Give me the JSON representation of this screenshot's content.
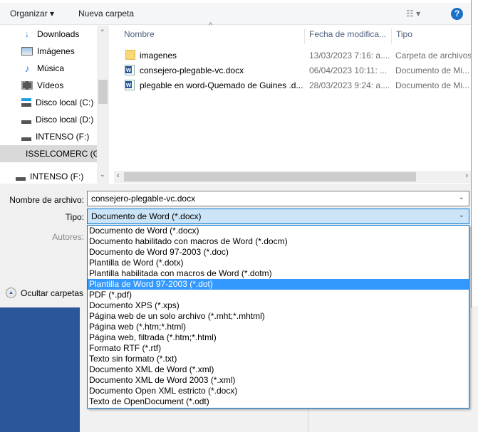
{
  "toolbar": {
    "organize": "Organizar ▾",
    "new_folder": "Nueva carpeta",
    "view_icon": "view-details-icon",
    "help": "?"
  },
  "nav": {
    "items": [
      {
        "label": "Downloads",
        "icon": "download-arrow-icon"
      },
      {
        "label": "Imágenes",
        "icon": "pictures-icon"
      },
      {
        "label": "Música",
        "icon": "music-note-icon"
      },
      {
        "label": "Vídeos",
        "icon": "video-icon"
      },
      {
        "label": "Disco local (C:)",
        "icon": "drive-windows-icon"
      },
      {
        "label": "Disco local (D:)",
        "icon": "drive-icon"
      },
      {
        "label": "INTENSO (F:)",
        "icon": "usb-drive-icon"
      },
      {
        "label": "ISSELCOMERC (G:)",
        "icon": "usb-drive-icon"
      },
      {
        "label": "INTENSO (F:)",
        "icon": "usb-drive-icon"
      }
    ]
  },
  "columns": {
    "name": "Nombre",
    "date": "Fecha de modifica...",
    "type": "Tipo"
  },
  "files": [
    {
      "name": "imagenes",
      "date": "13/03/2023 7:16: a....",
      "type": "Carpeta de archivos",
      "icon": "folder-icon"
    },
    {
      "name": "consejero-plegable-vc.docx",
      "date": "06/04/2023 10:11: ...",
      "type": "Documento de Mi...",
      "icon": "word-doc-icon"
    },
    {
      "name": "plegable en word-Quemado de Guines .d...",
      "date": "28/03/2023 9:24: a....",
      "type": "Documento de Mi...",
      "icon": "word-doc-icon"
    }
  ],
  "form": {
    "filename_label": "Nombre de archivo:",
    "filename_value": "consejero-plegable-vc.docx",
    "type_label": "Tipo:",
    "type_value": "Documento de Word (*.docx)",
    "authors_label": "Autores:",
    "hide_folders": "Ocultar carpetas"
  },
  "type_options": [
    "Documento de Word (*.docx)",
    "Documento habilitado con macros de Word (*.docm)",
    "Documento de Word 97-2003 (*.doc)",
    "Plantilla de Word (*.dotx)",
    "Plantilla habilitada con macros de Word (*.dotm)",
    "Plantilla de Word 97-2003 (*.dot)",
    "PDF (*.pdf)",
    "Documento XPS (*.xps)",
    "Página web de un solo archivo (*.mht;*.mhtml)",
    "Página web (*.htm;*.html)",
    "Página web, filtrada (*.htm;*.html)",
    "Formato RTF (*.rtf)",
    "Texto sin formato (*.txt)",
    "Documento XML de Word (*.xml)",
    "Documento XML de Word 2003 (*.xml)",
    "Documento Open XML estricto (*.docx)",
    "Texto de OpenDocument (*.odt)"
  ],
  "highlighted_option": "Plantilla de Word 97-2003 (*.dot)",
  "colors": {
    "accent": "#0078d7",
    "highlight": "#3399ff",
    "backstage": "#2b579a"
  }
}
